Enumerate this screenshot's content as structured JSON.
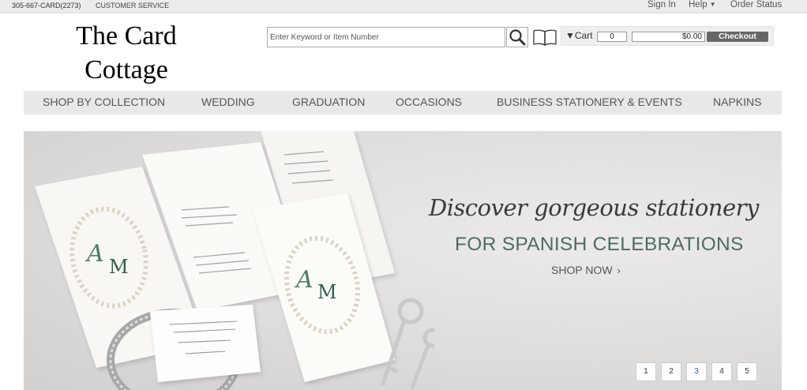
{
  "topbar": {
    "phone": "305-667-CARD(2273)",
    "customer_service": "CUSTOMER SERVICE",
    "sign_in": "Sign In",
    "help": "Help",
    "order_status": "Order Status"
  },
  "logo": {
    "line1": "The Card",
    "line2": "Cottage"
  },
  "search": {
    "placeholder": "Enter Keyword or Item Number",
    "button_icon": "search-icon",
    "catalog_icon": "book-icon"
  },
  "cart": {
    "label": "Cart",
    "count": "0",
    "total": "$0.00",
    "checkout": "Checkout"
  },
  "nav": {
    "items": [
      "SHOP BY COLLECTION",
      "WEDDING",
      "GRADUATION",
      "OCCASIONS",
      "BUSINESS STATIONERY & EVENTS",
      "NAPKINS"
    ]
  },
  "hero": {
    "title": "Discover gorgeous stationery",
    "subtitle": "FOR SPANISH CELEBRATIONS",
    "cta": "SHOP NOW",
    "monogram_left": "A",
    "monogram_right": "M",
    "pages": [
      "1",
      "2",
      "3",
      "4",
      "5"
    ],
    "active_page": "3"
  },
  "colors": {
    "accent_green": "#4e6d5e",
    "checkout_bg": "#666666",
    "nav_bg": "#e8e8e8"
  }
}
